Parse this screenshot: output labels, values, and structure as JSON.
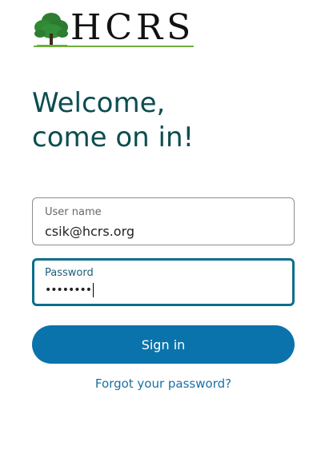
{
  "logo": {
    "text": "HCRS",
    "icon": "tree-icon",
    "colors": {
      "tree": "#2e7d32",
      "underline": "#6fae3a"
    }
  },
  "welcome": {
    "line1": "Welcome,",
    "line2": "come on in!"
  },
  "form": {
    "username_label": "User name",
    "username_value": "csik@hcrs.org",
    "password_label": "Password",
    "password_value": "••••••••",
    "signin_label": "Sign in",
    "forgot_label": "Forgot your password?"
  },
  "colors": {
    "heading": "#0b4d50",
    "button": "#0a73ab",
    "link": "#1a6fa6",
    "focus_border": "#0d6e8c"
  }
}
